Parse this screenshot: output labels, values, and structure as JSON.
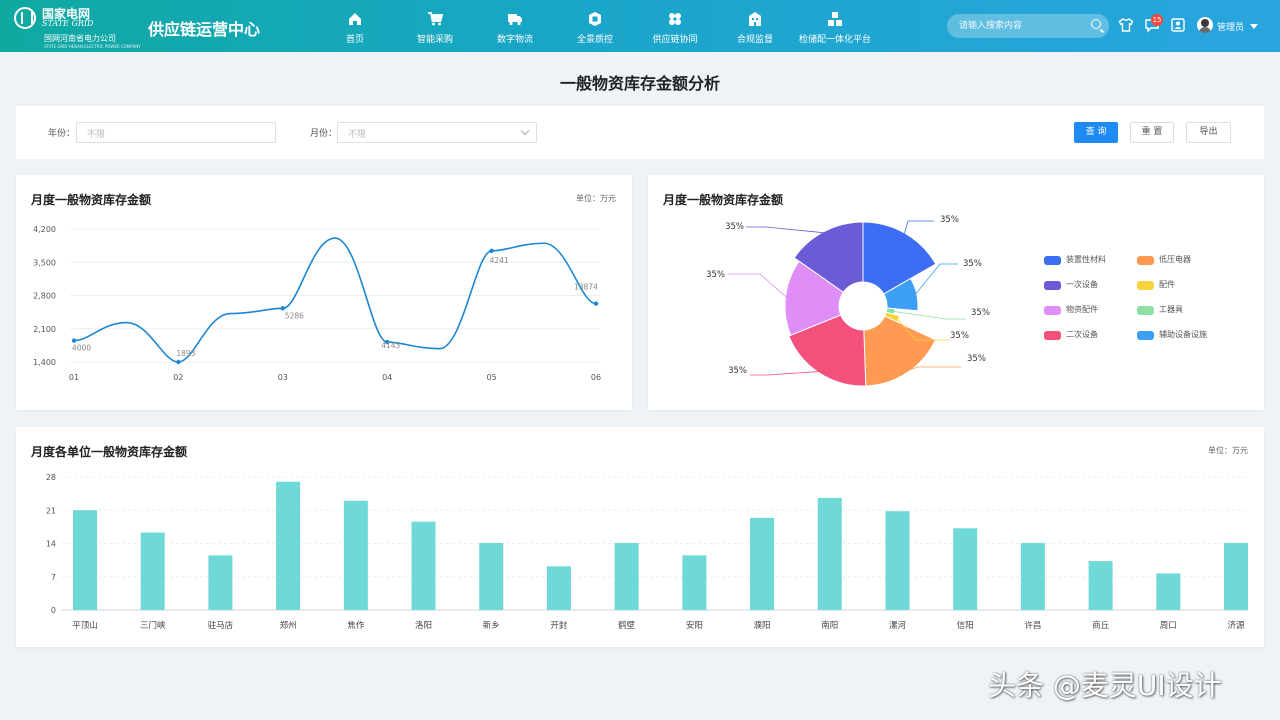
{
  "header": {
    "logo_cn": "国家电网",
    "logo_en": "STATE GRID",
    "logo_sub": "国网河南省电力公司",
    "logo_sub_en": "STATE GRID HENAN ELECTRIC POWER COMPANY",
    "brand": "供应链运营中心",
    "nav": [
      {
        "label": "首页",
        "icon": "home-icon"
      },
      {
        "label": "智能采购",
        "icon": "cart-icon"
      },
      {
        "label": "数字物流",
        "icon": "truck-icon"
      },
      {
        "label": "全景质控",
        "icon": "shield-icon"
      },
      {
        "label": "供应链协同",
        "icon": "fan-icon"
      },
      {
        "label": "合规监督",
        "icon": "building-icon"
      },
      {
        "label": "检储配一体化平台",
        "icon": "boxes-icon"
      }
    ],
    "search_placeholder": "请输入搜索内容",
    "notification_count": "15",
    "user": "管理员"
  },
  "page": {
    "title": "一般物资库存金额分析"
  },
  "filter": {
    "year_label": "年份：",
    "year_placeholder": "不限",
    "month_label": "月份：",
    "month_placeholder": "不限",
    "query": "查 询",
    "reset": "重 置",
    "export": "导出"
  },
  "line_panel": {
    "title": "月度一般物资库存金额",
    "unit": "单位：万元"
  },
  "pie_panel": {
    "title": "月度一般物资库存金额"
  },
  "bar_panel": {
    "title": "月度各单位一般物资库存金额",
    "unit": "单位：万元"
  },
  "chart_data": [
    {
      "type": "line",
      "categories": [
        "01",
        "02",
        "03",
        "04",
        "05",
        "06"
      ],
      "values": [
        1850,
        1400,
        2530,
        1820,
        3740,
        2630
      ],
      "point_labels": [
        "4000",
        "1893",
        "5286",
        "4143",
        "4241",
        "13874"
      ],
      "yticks": [
        "1,400",
        "2,100",
        "2,800",
        "3,500",
        "4,200"
      ],
      "ylim": [
        1400,
        4200
      ],
      "color": "#1b86d3",
      "grid": true
    },
    {
      "type": "pie",
      "variant": "rose",
      "labels": [
        "装置性材料",
        "低压电器",
        "一次设备",
        "配件",
        "物资配件",
        "工器具",
        "二次设备",
        "辅助设备设施"
      ],
      "slice_labels": [
        "35%",
        "35%",
        "35%",
        "35%",
        "35%",
        "35%",
        "35%",
        "35%"
      ],
      "colors": [
        "#3d6df2",
        "#ff9a52",
        "#6b5bd6",
        "#f9d33b",
        "#df8df7",
        "#8ddfa6",
        "#f3517c",
        "#3a9ff5"
      ],
      "legend": "right"
    },
    {
      "type": "bar",
      "categories": [
        "平顶山",
        "三门峡",
        "驻马店",
        "郑州",
        "焦作",
        "洛阳",
        "新乡",
        "开封",
        "鹤壁",
        "安阳",
        "濮阳",
        "南阳",
        "漯河",
        "信阳",
        "许昌",
        "商丘",
        "周口",
        "济源"
      ],
      "values": [
        21,
        16.3,
        11.5,
        27,
        23,
        18.6,
        14.1,
        9.2,
        14.1,
        11.5,
        19.4,
        23.6,
        20.8,
        17.2,
        14.1,
        10.3,
        7.7,
        14.1
      ],
      "yticks": [
        "0",
        "7",
        "14",
        "21",
        "28"
      ],
      "ylim": [
        0,
        28
      ],
      "color": "#6ed9d6",
      "grid": true
    }
  ],
  "watermark": "头条 @麦灵UI设计"
}
